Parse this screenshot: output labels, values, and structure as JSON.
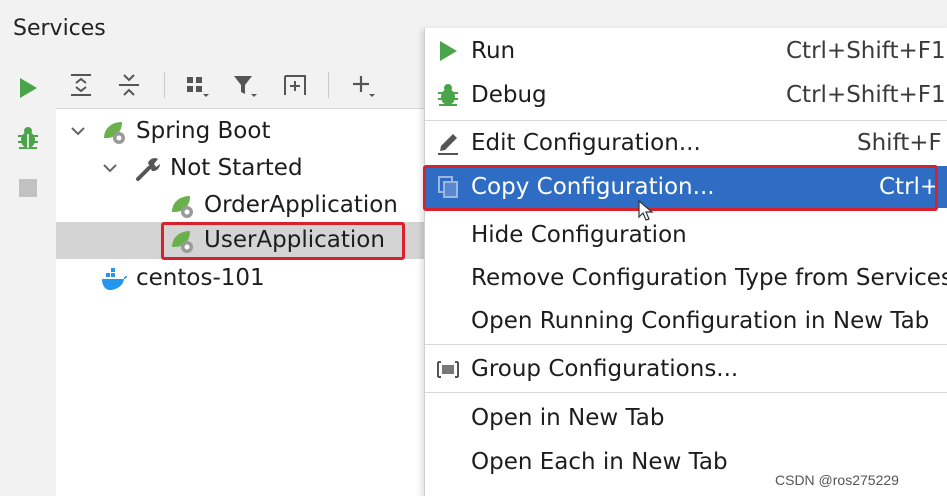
{
  "panel": {
    "title": "Services"
  },
  "left_toolbar": [
    {
      "name": "run-icon"
    },
    {
      "name": "debug-icon"
    },
    {
      "name": "stop-icon"
    }
  ],
  "top_toolbar": [
    {
      "name": "expand-all-icon"
    },
    {
      "name": "collapse-all-icon"
    },
    {
      "name": "group-by-icon"
    },
    {
      "name": "filter-icon"
    },
    {
      "name": "new-tab-icon"
    },
    {
      "name": "add-icon"
    }
  ],
  "tree": {
    "spring_boot": "Spring Boot",
    "not_started": "Not Started",
    "order_app": "OrderApplication",
    "user_app": "UserApplication",
    "centos": "centos-101"
  },
  "menu": {
    "run": {
      "label": "Run",
      "shortcut": "Ctrl+Shift+F1"
    },
    "debug": {
      "label": "Debug",
      "shortcut": "Ctrl+Shift+F1"
    },
    "edit": {
      "label": "Edit Configuration...",
      "shortcut": "Shift+F"
    },
    "copy": {
      "label": "Copy Configuration...",
      "shortcut": "Ctrl+"
    },
    "hide": {
      "label": "Hide Configuration"
    },
    "remove": {
      "label": "Remove Configuration Type from Services"
    },
    "open_running": {
      "label": "Open Running Configuration in New Tab"
    },
    "group": {
      "label": "Group Configurations..."
    },
    "open_tab": {
      "label": "Open in New Tab"
    },
    "open_each": {
      "label": "Open Each in New Tab"
    }
  },
  "watermark": "CSDN @ros275229",
  "colors": {
    "accent": "#2f6dc4",
    "highlight": "#d9202b",
    "run_green": "#4aa54a"
  }
}
